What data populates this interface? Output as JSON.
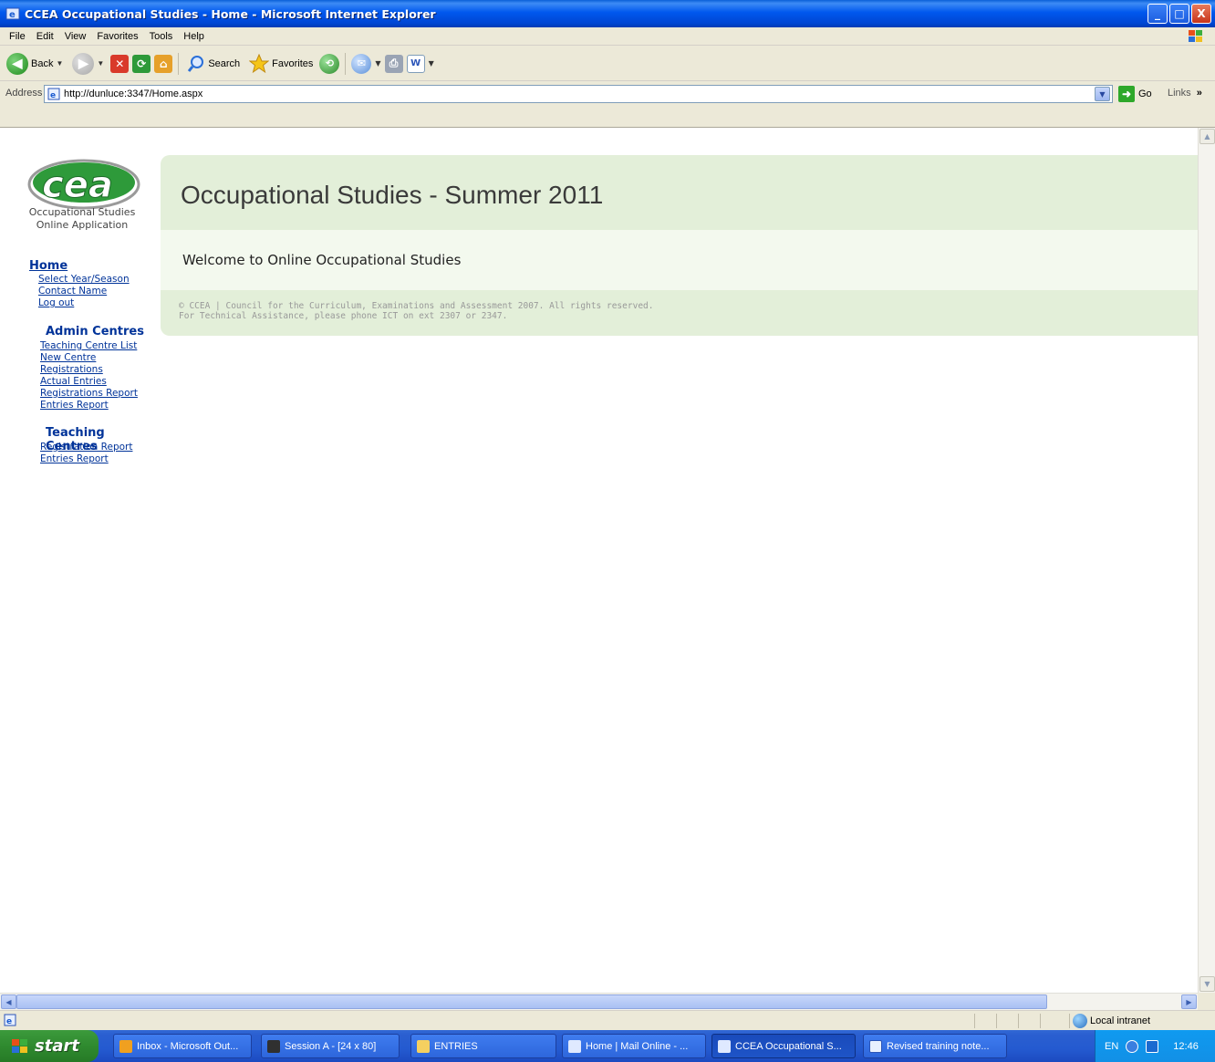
{
  "window": {
    "title": "CCEA Occupational Studies - Home - Microsoft Internet Explorer",
    "buttons": {
      "minimize": "_",
      "maximize": "□",
      "close": "X"
    }
  },
  "menubar": {
    "items": [
      "File",
      "Edit",
      "View",
      "Favorites",
      "Tools",
      "Help"
    ]
  },
  "toolbar": {
    "back_label": "Back",
    "search_label": "Search",
    "favorites_label": "Favorites",
    "icons": [
      "back-icon",
      "forward-icon",
      "stop-icon",
      "refresh-icon",
      "home-icon",
      "search-icon",
      "favorites-icon",
      "history-icon",
      "mail-icon",
      "print-icon",
      "word-icon"
    ]
  },
  "addressbar": {
    "label": "Address",
    "url": "http://dunluce:3347/Home.aspx",
    "go_label": "Go",
    "links_label": "Links",
    "links_chevron": "»"
  },
  "sidebar": {
    "logo_text": "cea",
    "logo_sub_line1": "Occupational Studies",
    "logo_sub_line2": "Online Application",
    "home_label": "Home",
    "home_links": [
      "Select Year/Season",
      "Contact Name",
      "Log out"
    ],
    "admin_heading": "Admin Centres",
    "admin_links": [
      "Teaching Centre List",
      "New Centre",
      "Registrations",
      "Actual Entries",
      "Registrations Report",
      "Entries Report"
    ],
    "teaching_heading": "Teaching Centres",
    "teaching_links": [
      "Registration Report",
      "Entries Report"
    ]
  },
  "main": {
    "heading": "Occupational Studies - Summer 2011",
    "welcome": "Welcome to Online Occupational Studies",
    "footer_line1": "© CCEA | Council for the Curriculum, Examinations and Assessment 2007. All rights reserved.",
    "footer_line2": "For Technical Assistance, please phone ICT on ext 2307 or 2347."
  },
  "statusbar": {
    "zone": "Local intranet"
  },
  "taskbar": {
    "start_label": "start",
    "tasks": [
      {
        "label": "Inbox - Microsoft Out...",
        "icon": "outlook-icon"
      },
      {
        "label": "Session A - [24 x 80]",
        "icon": "terminal-icon"
      },
      {
        "label": "ENTRIES",
        "icon": "folder-icon"
      },
      {
        "label": "Home | Mail Online - ...",
        "icon": "ie-icon"
      },
      {
        "label": "CCEA Occupational S...",
        "icon": "ie-icon"
      },
      {
        "label": "Revised training note...",
        "icon": "word-icon"
      }
    ],
    "tray": {
      "language": "EN",
      "time": "12:46"
    }
  },
  "colors": {
    "titlebar": "#0058ee",
    "link": "#003399",
    "main_band": "#e3efd9",
    "welcome_band": "#f3f9ee",
    "taskbar": "#245ad0",
    "start": "#2f8a2f"
  }
}
